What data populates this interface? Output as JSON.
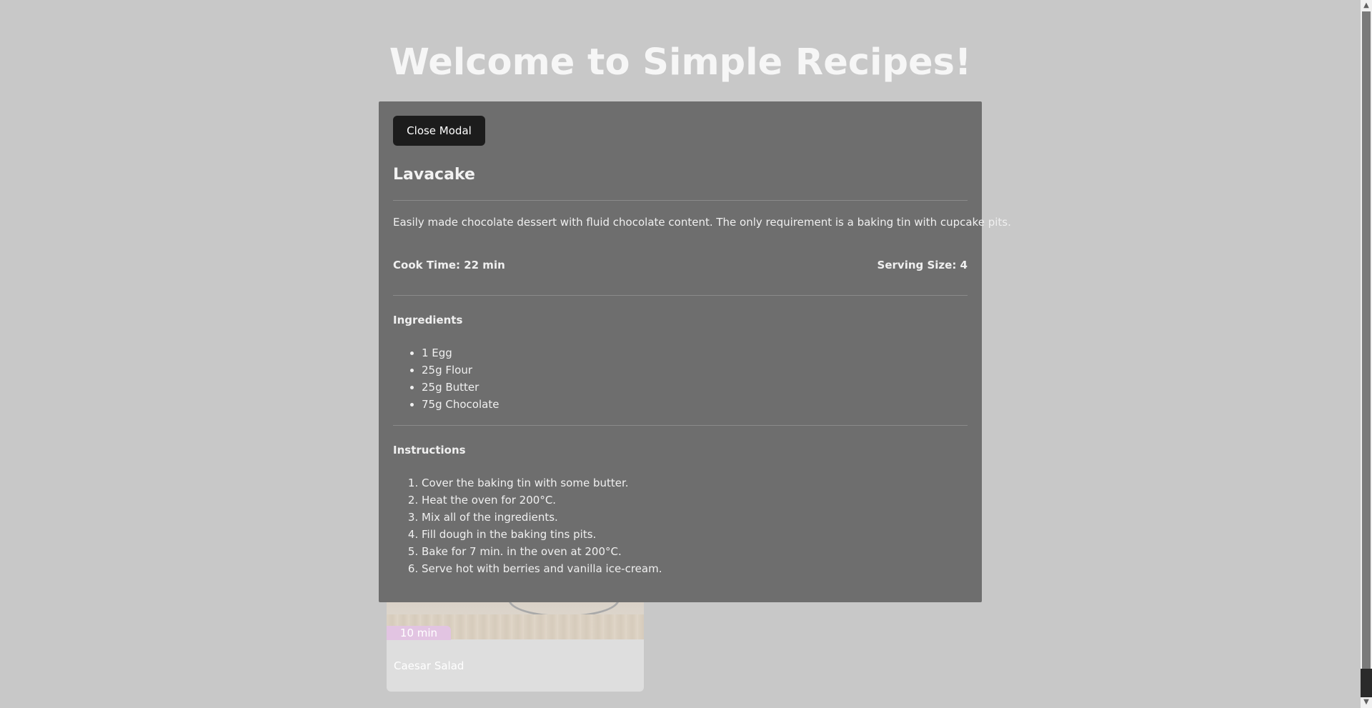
{
  "page": {
    "title": "Welcome to Simple Recipes!"
  },
  "background_card": {
    "time_badge": "10 min",
    "name": "Caesar Salad"
  },
  "modal": {
    "close_label": "Close Modal",
    "title": "Lavacake",
    "description": "Easily made chocolate dessert with fluid chocolate content. The only requirement is a baking tin with cupcake pits.",
    "cook_time": "Cook Time: 22 min",
    "serving_size": "Serving Size: 4",
    "ingredients_heading": "Ingredients",
    "ingredients": [
      "1 Egg",
      "25g Flour",
      "25g Butter",
      "75g Chocolate"
    ],
    "instructions_heading": "Instructions",
    "instructions": [
      "Cover the baking tin with some butter.",
      "Heat the oven for 200°C.",
      "Mix all of the ingredients.",
      "Fill dough in the baking tins pits.",
      "Bake for 7 min. in the oven at 200°C.",
      "Serve hot with berries and vanilla ice-cream."
    ]
  },
  "colors": {
    "overlay_background": "#c8c8c8",
    "modal_background": "#6e6e6e",
    "close_button": "#1c1c1c",
    "time_badge": "#e2c4e2"
  },
  "icons": {
    "scroll_up": "chevron-up-icon",
    "scroll_down": "chevron-down-icon"
  }
}
